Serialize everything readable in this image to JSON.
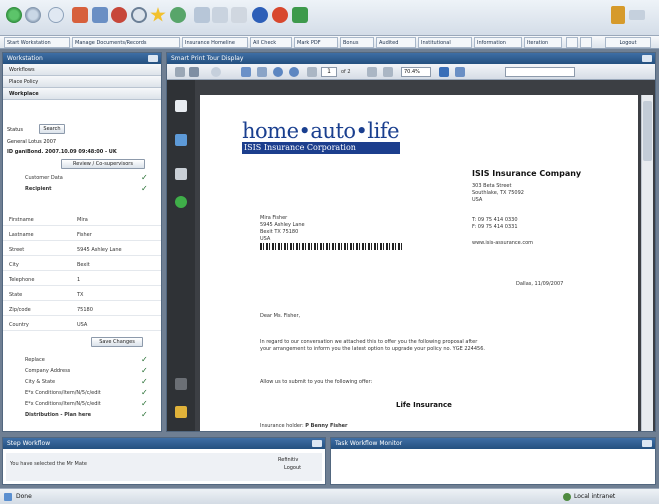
{
  "menu": [
    "Start Workstation",
    "Manage Documents/Records",
    "Insurance Homeline",
    "All Check",
    "Mark PDF",
    "Bonus",
    "Audited",
    "Institutional",
    "Information",
    "Iteration"
  ],
  "top_right_label": "Logout",
  "left_panel": {
    "title": "Workstation",
    "sections": [
      "Workflows",
      "Place Policy",
      "Workplace"
    ],
    "status_label": "Status",
    "search_button": "Search",
    "license_line": "General Lotus 2007",
    "id_line": "ID ganiBond. 2007.10.09 09:48:00 - UK",
    "review_button": "Review / Co-supervisors",
    "checks_top": [
      {
        "label": "Customer Data",
        "checked": true
      },
      {
        "label": "Recipient",
        "checked": true
      }
    ],
    "fields": [
      {
        "label": "Firstname",
        "value": "Mira"
      },
      {
        "label": "Lastname",
        "value": "Fisher"
      },
      {
        "label": "Street",
        "value": "5945 Ashley Lane"
      },
      {
        "label": "City",
        "value": "Bexit"
      },
      {
        "label": "Telephone",
        "value": "1"
      },
      {
        "label": "State",
        "value": "TX"
      },
      {
        "label": "Zip/code",
        "value": "75180"
      },
      {
        "label": "Country",
        "value": "USA"
      }
    ],
    "save_button": "Save Changes",
    "checks_bottom": [
      {
        "label": "Replace",
        "checked": true
      },
      {
        "label": "Company Address",
        "checked": true
      },
      {
        "label": "City & State",
        "checked": true
      },
      {
        "label": "E*x Conditions/Item/N/5/c/edit",
        "checked": true
      },
      {
        "label": "E*x Conditions/Item/N/5/c/edit",
        "checked": true
      },
      {
        "label": "Distribution - Plan here",
        "checked": true
      }
    ]
  },
  "viewer": {
    "title": "Smart Print Tour Display",
    "zoom": "70.4%",
    "page_box": "1",
    "page_of": "of 2",
    "document": {
      "logo_text": "home•auto•life",
      "logo_sub": "ISIS Insurance Corporation",
      "company_name": "ISIS Insurance Company",
      "company_addr": [
        "303 Beta Street",
        "Southlake, TX 75092",
        "USA"
      ],
      "company_contact": [
        "T: 09 75 414 0330",
        "F: 09 75 414 0331",
        "www.isis-assurance.com"
      ],
      "recipient": [
        "Mira Fisher",
        "5945 Ashley Lane",
        "Bexit TX 75180",
        "USA"
      ],
      "date": "Dallas, 11/09/2007",
      "greeting": "Dear Ms. Fisher,",
      "body_lines": [
        "In regard to our conversation we attached this to offer you the following proposal after",
        "your arrangement to inform you the latest option to upgrade your policy no. YGE 224456."
      ],
      "offer_intro": "Allow us to submit to you the following offer:",
      "offer_title": "Life Insurance",
      "holder_label": "Insurance holder: ",
      "holder_name": "P Benny Fisher"
    }
  },
  "bottom_left": {
    "title": "Step Workflow",
    "message": "You have selected the Mr Mate",
    "action_lines": [
      "Refinitiv",
      "Logout"
    ]
  },
  "bottom_right": {
    "title": "Task Workflow Monitor"
  },
  "status_bar": {
    "left": "Done",
    "right": "Local intranet"
  },
  "colors": {
    "brand_blue": "#1c3e8d",
    "panel_title": "#2d5a8f",
    "checkmark": "#1f6a2c"
  }
}
